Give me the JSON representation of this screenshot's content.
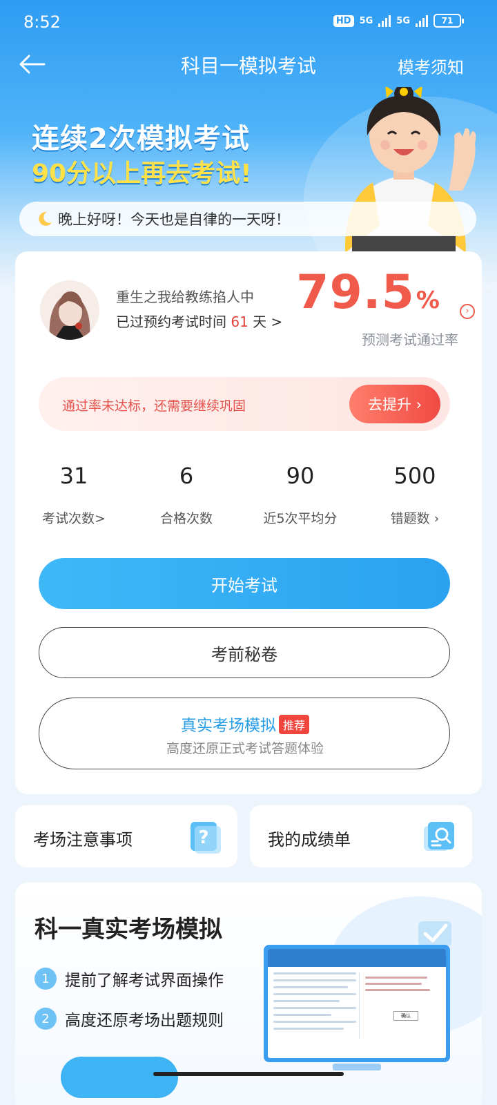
{
  "status_bar": {
    "time": "8:52",
    "hd": "HD",
    "net1": "5G",
    "net2": "5G",
    "battery": "71"
  },
  "nav": {
    "title": "科目一模拟考试",
    "right_link": "模考须知"
  },
  "promo": {
    "line1": "连续2次模拟考试",
    "line2": "90分以上再去考试!"
  },
  "greeting": "晚上好呀！今天也是自律的一天呀！",
  "profile": {
    "name": "重生之我给教练掐人中",
    "days_prefix": "已过预约考试时间",
    "days_value": "61",
    "days_suffix": "天 >"
  },
  "pass_rate": {
    "value": "79.5",
    "unit": "%",
    "label": "预测考试通过率"
  },
  "warning": {
    "text": "通过率未达标，还需要继续巩固",
    "button": "去提升 ›"
  },
  "stats": [
    {
      "value": "31",
      "label": "考试次数>"
    },
    {
      "value": "6",
      "label": "合格次数"
    },
    {
      "value": "90",
      "label": "近5次平均分"
    },
    {
      "value": "500",
      "label": "错题数 ›"
    }
  ],
  "buttons": {
    "start": "开始考试",
    "secret": "考前秘卷",
    "real_title": "真实考场模拟",
    "real_tag": "推荐",
    "real_sub": "高度还原正式考试答题体验"
  },
  "tiles": {
    "notes": "考场注意事项",
    "scores": "我的成绩单"
  },
  "bottom_card": {
    "title": "科一真实考场模拟",
    "items": [
      {
        "num": "1",
        "text": "提前了解考试界面操作"
      },
      {
        "num": "2",
        "text": "高度还原考场出题规则"
      }
    ],
    "screen_confirm": "确认"
  },
  "colors": {
    "primary_blue": "#2aa2f0",
    "alert_red": "#f05a4a"
  }
}
